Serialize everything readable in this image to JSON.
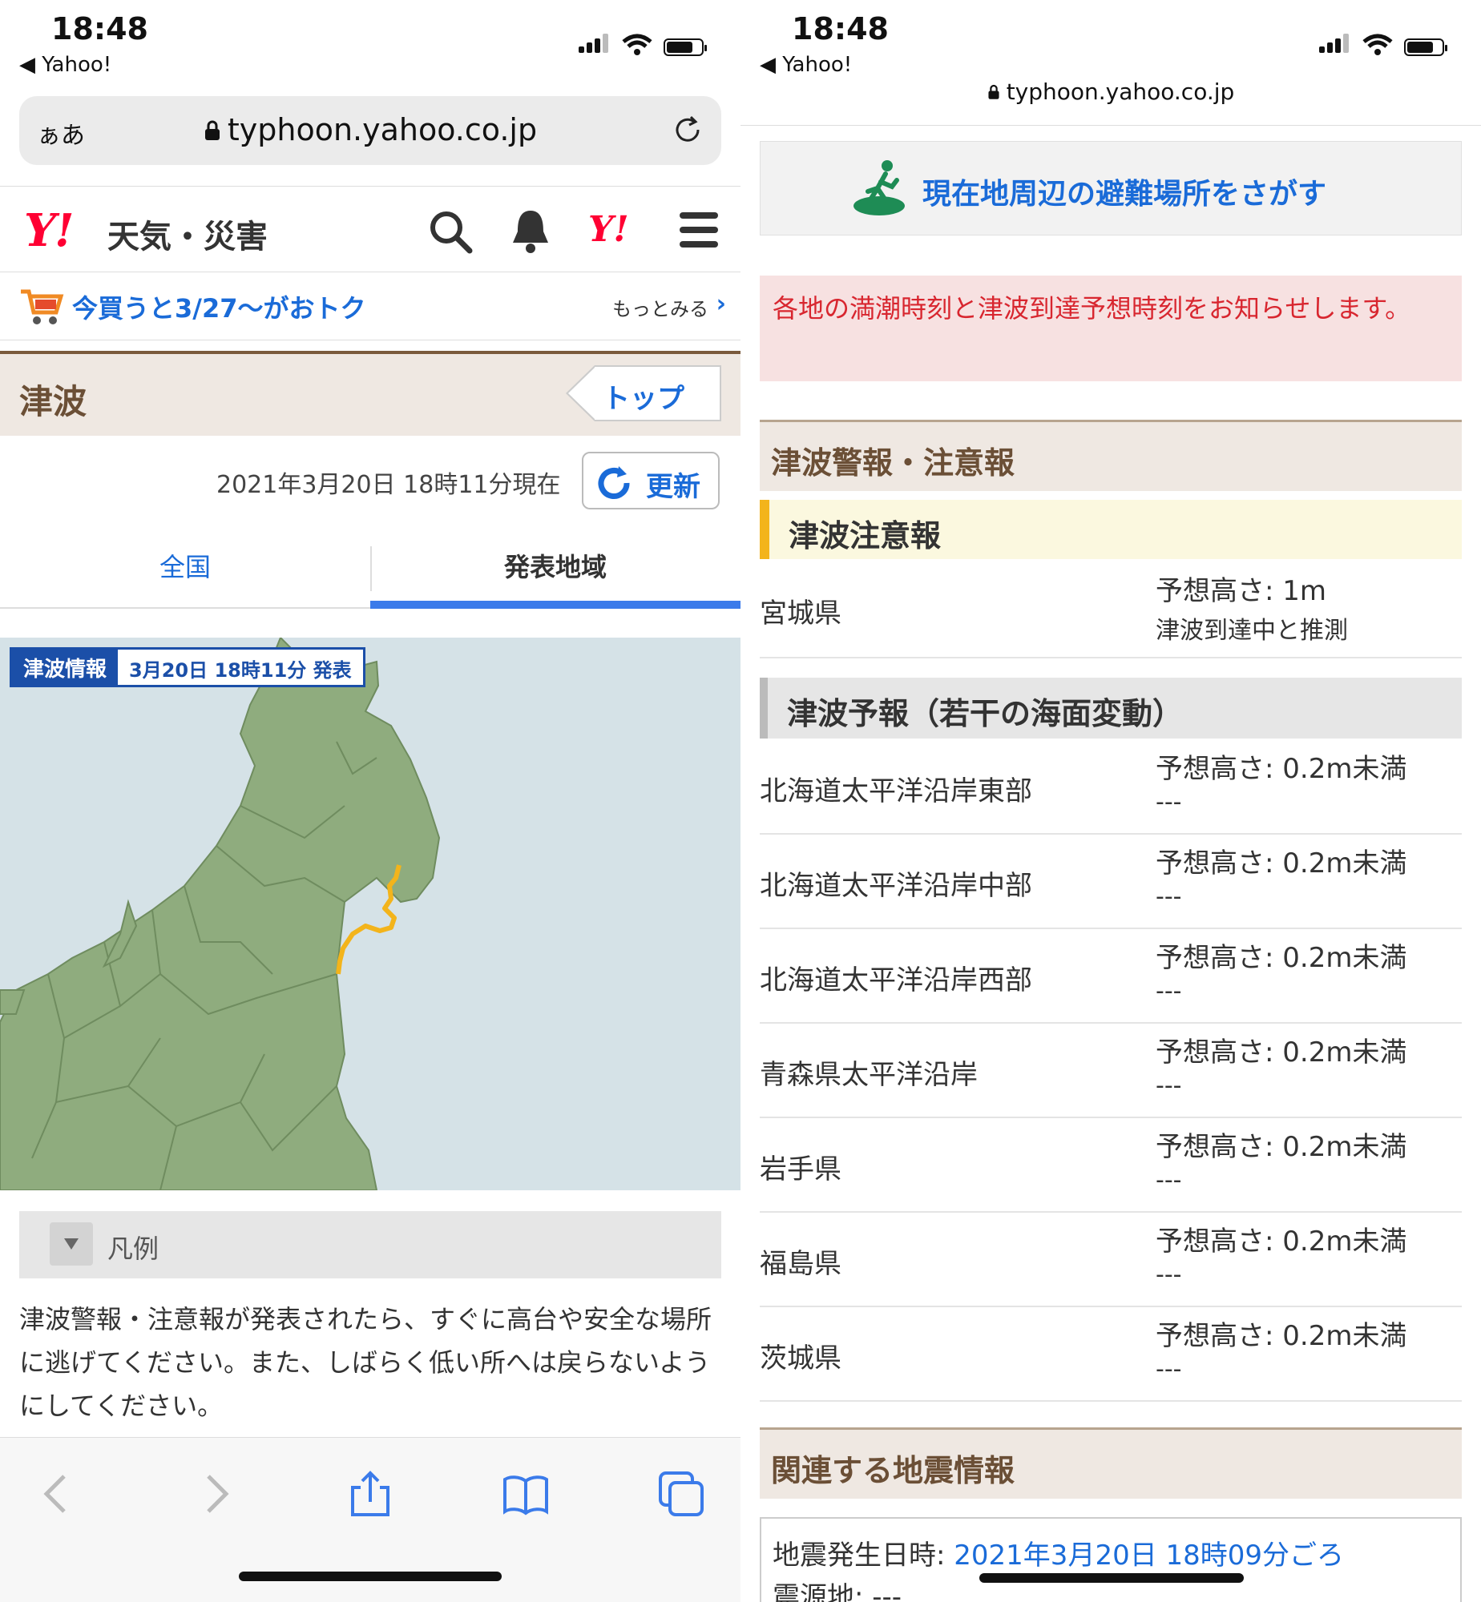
{
  "status": {
    "time": "18:48",
    "back_app": "◀ Yahoo!"
  },
  "left": {
    "urlbar": {
      "aa": "ぁあ",
      "url": "typhoon.yahoo.co.jp"
    },
    "header": {
      "logo": "Y!",
      "title": "天気・災害"
    },
    "promo": {
      "text": "今買うと3/27〜がおトク",
      "more": "もっとみる"
    },
    "section": {
      "title": "津波",
      "top_button": "トップ"
    },
    "updated": {
      "datetime": "2021年3月20日 18時11分現在",
      "button": "更新"
    },
    "tabs": [
      {
        "label": "全国",
        "active": false
      },
      {
        "label": "発表地域",
        "active": true
      }
    ],
    "map_badge": {
      "label": "津波情報",
      "date": "3月20日 18時11分 発表"
    },
    "legend": "凡例",
    "warning_text": "津波警報・注意報が発表されたら、すぐに高台や安全な場所に逃げてください。また、しばらく低い所へは戻らないようにしてください。"
  },
  "right": {
    "url": "typhoon.yahoo.co.jp",
    "evac_button": "現在地周辺の避難場所をさがす",
    "notice": "各地の満潮時刻と津波到達予想時刻をお知らせします。",
    "warnings_header": "津波警報・注意報",
    "advisory_header": "津波注意報",
    "advisory_rows": [
      {
        "name": "宮城県",
        "height": "予想高さ: 1m",
        "status": "津波到達中と推測"
      }
    ],
    "forecast_header": "津波予報（若干の海面変動）",
    "forecast_rows": [
      {
        "name": "北海道太平洋沿岸東部",
        "height": "予想高さ: 0.2m未満",
        "status": "---"
      },
      {
        "name": "北海道太平洋沿岸中部",
        "height": "予想高さ: 0.2m未満",
        "status": "---"
      },
      {
        "name": "北海道太平洋沿岸西部",
        "height": "予想高さ: 0.2m未満",
        "status": "---"
      },
      {
        "name": "青森県太平洋沿岸",
        "height": "予想高さ: 0.2m未満",
        "status": "---"
      },
      {
        "name": "岩手県",
        "height": "予想高さ: 0.2m未満",
        "status": "---"
      },
      {
        "name": "福島県",
        "height": "予想高さ: 0.2m未満",
        "status": "---"
      },
      {
        "name": "茨城県",
        "height": "予想高さ: 0.2m未満",
        "status": "---"
      }
    ],
    "quake_header": "関連する地震情報",
    "quake": {
      "label": "地震発生日時:",
      "value": "2021年3月20日 18時09分ごろ",
      "epicenter": "震源地: ---"
    }
  },
  "colors": {
    "accent": "#1a6bd8",
    "brand": "#ff0033",
    "coast_alert": "#f3b41b",
    "land": "#8fac7e",
    "sea": "#d5e2e7"
  },
  "icons": [
    "signal-icon",
    "wifi-icon",
    "battery-icon",
    "lock-icon",
    "reload-icon",
    "search-icon",
    "bell-icon",
    "menu-icon",
    "cart-icon",
    "refresh-icon",
    "evacuation-icon",
    "back-icon",
    "forward-icon",
    "share-icon",
    "bookmarks-icon",
    "tabs-icon"
  ]
}
